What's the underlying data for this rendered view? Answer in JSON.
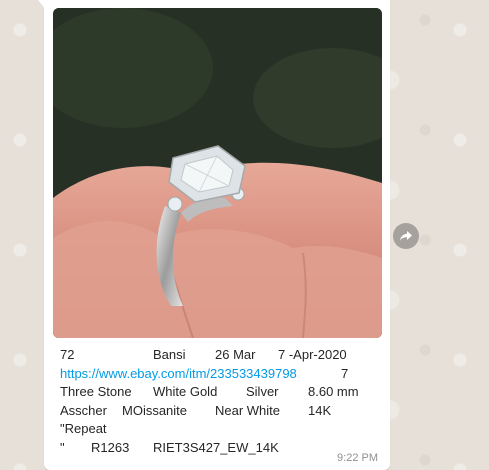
{
  "message": {
    "image_alt": "Three stone asscher cut ring worn on a finger",
    "caption_lines": [
      [
        "72",
        "Bansi",
        "26 Mar",
        "7 -Apr-2020"
      ],
      [
        "https://www.ebay.com/itm/233533439798",
        "7"
      ],
      [
        "Three Stone",
        "White Gold",
        "Silver",
        "8.60 mm"
      ],
      [
        "Asscher",
        "MOissanite",
        "Near White",
        "14K"
      ],
      [
        "\"Repeat"
      ],
      [
        "\"",
        "R1263",
        "RIET3S427_EW_14K"
      ]
    ],
    "time": "9:22 PM"
  },
  "actions": {
    "forward_icon": "forward-arrow-icon"
  },
  "colors": {
    "bubble": "#ffffff",
    "link": "#039be5",
    "wallpaper": "#e5ddd5"
  }
}
